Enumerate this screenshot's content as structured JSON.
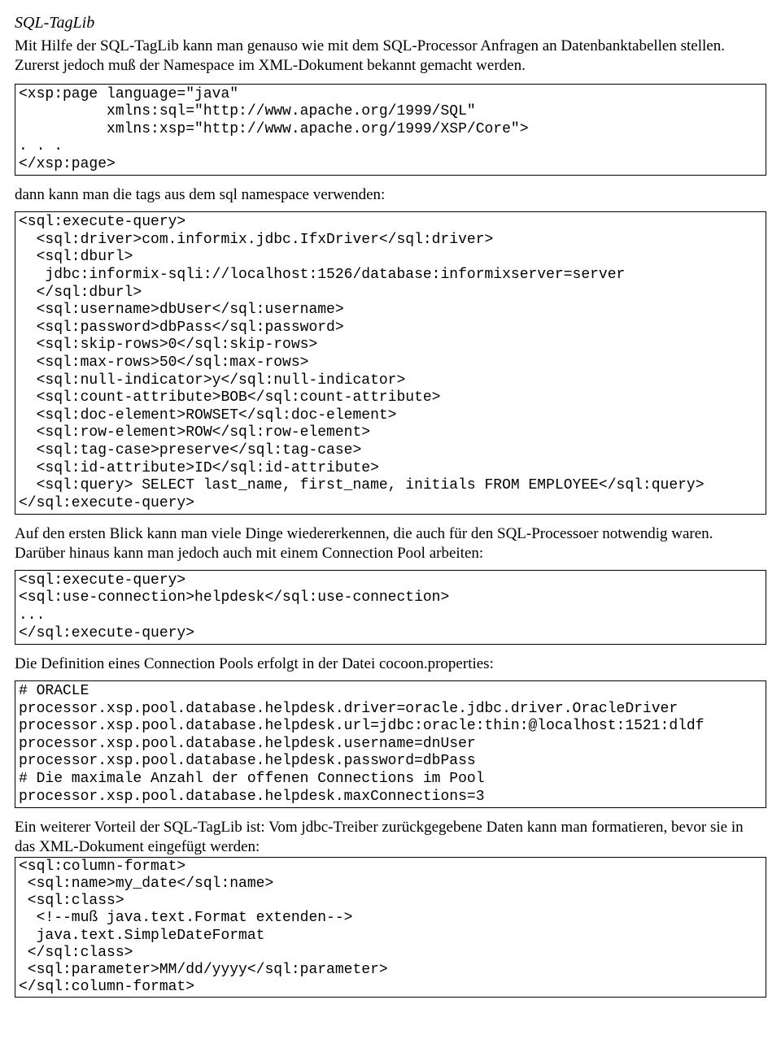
{
  "heading": "SQL-TagLib",
  "intro": "Mit Hilfe der SQL-TagLib kann man genauso wie mit dem SQL-Processor Anfragen an Datenbanktabellen stellen. Zurerst jedoch muß der Namespace im XML-Dokument bekannt gemacht werden.",
  "code1": "<xsp:page language=\"java\"\n          xmlns:sql=\"http://www.apache.org/1999/SQL\"\n          xmlns:xsp=\"http://www.apache.org/1999/XSP/Core\">\n. . .\n</xsp:page>",
  "inter1": "dann kann man die tags aus dem sql namespace verwenden:",
  "code2": "<sql:execute-query>\n  <sql:driver>com.informix.jdbc.IfxDriver</sql:driver>\n  <sql:dburl>\n   jdbc:informix-sqli://localhost:1526/database:informixserver=server\n  </sql:dburl>\n  <sql:username>dbUser</sql:username>\n  <sql:password>dbPass</sql:password>\n  <sql:skip-rows>0</sql:skip-rows>\n  <sql:max-rows>50</sql:max-rows>\n  <sql:null-indicator>y</sql:null-indicator>\n  <sql:count-attribute>BOB</sql:count-attribute>\n  <sql:doc-element>ROWSET</sql:doc-element>\n  <sql:row-element>ROW</sql:row-element>\n  <sql:tag-case>preserve</sql:tag-case>\n  <sql:id-attribute>ID</sql:id-attribute>\n  <sql:query> SELECT last_name, first_name, initials FROM EMPLOYEE</sql:query>\n</sql:execute-query>",
  "inter2": "Auf den ersten Blick kann man viele Dinge wiedererkennen, die auch für den SQL-Processoer notwendig waren. Darüber hinaus kann man jedoch auch mit einem Connection Pool arbeiten:",
  "code3": "<sql:execute-query>\n<sql:use-connection>helpdesk</sql:use-connection>\n...\n</sql:execute-query>",
  "inter3": "Die Definition eines Connection Pools erfolgt in der Datei cocoon.properties:",
  "code4": "# ORACLE\nprocessor.xsp.pool.database.helpdesk.driver=oracle.jdbc.driver.OracleDriver\nprocessor.xsp.pool.database.helpdesk.url=jdbc:oracle:thin:@localhost:1521:dldf\nprocessor.xsp.pool.database.helpdesk.username=dnUser\nprocessor.xsp.pool.database.helpdesk.password=dbPass\n# Die maximale Anzahl der offenen Connections im Pool\nprocessor.xsp.pool.database.helpdesk.maxConnections=3",
  "inter4": "Ein weiterer Vorteil der SQL-TagLib ist: Vom jdbc-Treiber zurückgegebene Daten kann man formatieren, bevor sie in das XML-Dokument eingefügt werden:",
  "code5": "<sql:column-format>\n <sql:name>my_date</sql:name>\n <sql:class>\n  <!--muß java.text.Format extenden-->\n  java.text.SimpleDateFormat\n </sql:class>\n <sql:parameter>MM/dd/yyyy</sql:parameter>\n</sql:column-format>"
}
